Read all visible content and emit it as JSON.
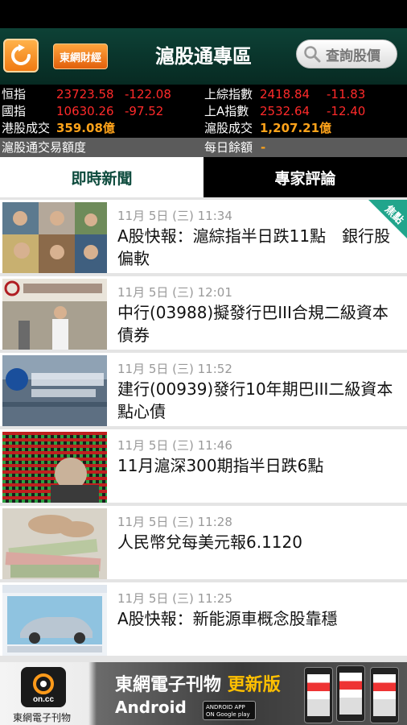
{
  "header": {
    "brand_label": "東網財經",
    "title": "滬股通專區",
    "search_label": "查詢股價"
  },
  "ticker": {
    "hsi_label": "恒指",
    "hsi_value": "23723.58",
    "hsi_change": "-122.08",
    "sci_label": "上綜指數",
    "sci_value": "2418.84",
    "sci_change": "-11.83",
    "hscei_label": "國指",
    "hscei_value": "10630.26",
    "hscei_change": "-97.52",
    "sai_label": "上A指數",
    "sai_value": "2532.64",
    "sai_change": "-12.40",
    "hk_turnover_label": "港股成交",
    "hk_turnover_value": "359.08億",
    "sh_turnover_label": "滬股成交",
    "sh_turnover_value": "1,207.21億"
  },
  "quota": {
    "label": "滬股通交易額度",
    "daily_label": "每日餘額",
    "daily_value": "-"
  },
  "tabs": [
    {
      "label": "即時新聞",
      "active": true
    },
    {
      "label": "專家評論",
      "active": false
    }
  ],
  "news": [
    {
      "time": "11月 5日 (三) 11:34",
      "title": "A股快報：滬綜指半日跌11點　銀行股偏軟",
      "badge": "焦點"
    },
    {
      "time": "11月 5日 (三) 12:01",
      "title": "中行(03988)擬發行巴III合規二級資本債券"
    },
    {
      "time": "11月 5日 (三) 11:52",
      "title": "建行(00939)發行10年期巴III二級資本點心債"
    },
    {
      "time": "11月 5日 (三) 11:46",
      "title": "11月滬深300期指半日跌6點"
    },
    {
      "time": "11月 5日 (三) 11:28",
      "title": "人民幣兌每美元報6.1120"
    },
    {
      "time": "11月 5日 (三) 11:25",
      "title": "A股快報：新能源車概念股靠穩"
    }
  ],
  "ad": {
    "logo_text": "on.cc",
    "caption": "東網電子刊物",
    "title_main": "東網電子刊物",
    "title_highlight": "更新版",
    "platform": "Android",
    "store_badge": "ANDROID APP ON Google play"
  },
  "colors": {
    "header_bg": "#0d4136",
    "accent_orange": "#f07a12",
    "index_red": "#ff2a2a",
    "turnover_orange": "#ffa31a",
    "badge_teal": "#21a58c"
  }
}
